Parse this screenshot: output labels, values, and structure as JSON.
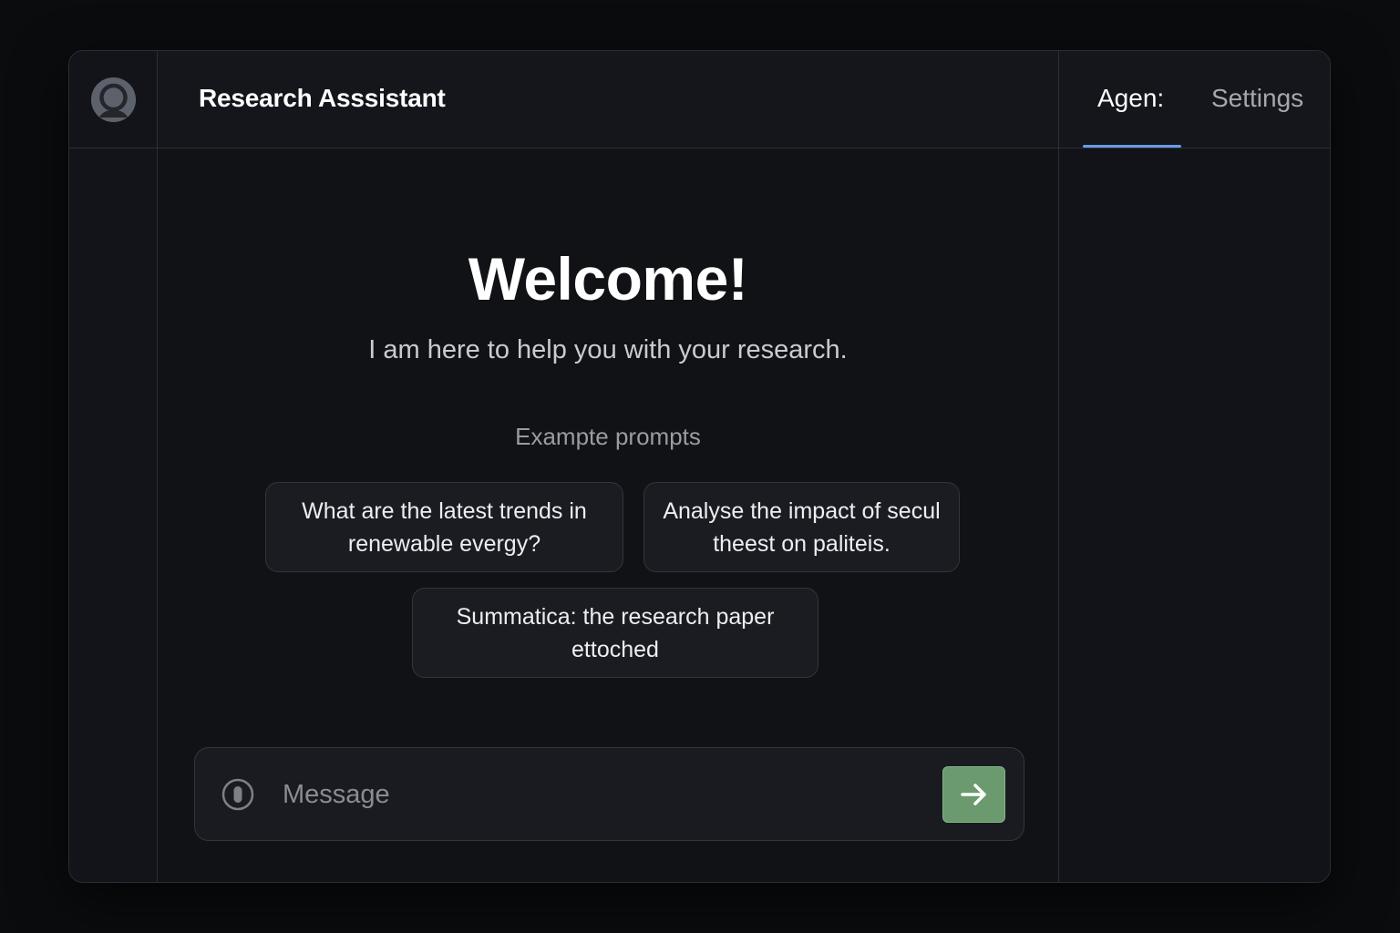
{
  "header": {
    "app_title": "Research Asssistant"
  },
  "side_panel": {
    "tabs": [
      {
        "label": "Agen:",
        "active": true
      },
      {
        "label": "Settings",
        "active": false
      }
    ]
  },
  "main": {
    "welcome": "Welcome!",
    "subtitle": "I am here to help you with your research.",
    "prompts_label": "Exampte prompts",
    "prompts": [
      {
        "text": "What are the latest trends in renewable evergy?"
      },
      {
        "text": "Analyse the impact of secul theest on paliteis."
      },
      {
        "text": "Summatica: the research paper ettoched"
      }
    ]
  },
  "composer": {
    "placeholder": "Message",
    "attach_icon": "attach-icon",
    "send_icon": "arrow-right-icon"
  },
  "colors": {
    "background": "#0b0c0e",
    "panel": "#131419",
    "send_button": "#6a9a6e",
    "active_tab_underline": "#6b9be8"
  }
}
